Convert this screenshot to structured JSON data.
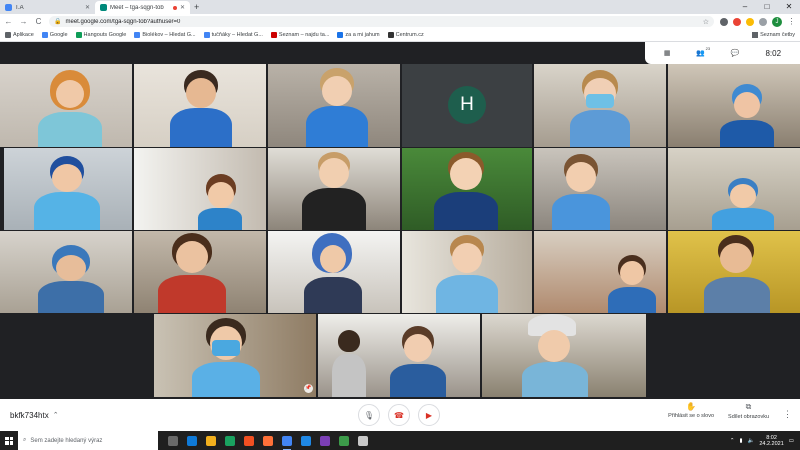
{
  "browser": {
    "tabs": [
      {
        "title": "T.A",
        "active": false,
        "favicon_color": "#4285f4"
      },
      {
        "title": "Meet – tga-sqgn-tob",
        "active": true,
        "favicon_color": "#00897b",
        "recording": true
      }
    ],
    "new_tab": "+",
    "window_controls": {
      "minimize": "–",
      "maximize": "□",
      "close": "✕"
    },
    "nav": {
      "back": "←",
      "forward": "→",
      "reload": "C"
    },
    "url": "meet.google.com/tga-sqgn-tob?authuser=0",
    "profile_initial": "J",
    "bookmarks": [
      {
        "label": "Aplikace",
        "color": "#5f6368"
      },
      {
        "label": "Google",
        "color": "#4285f4"
      },
      {
        "label": "Hangouts Google",
        "color": "#0f9d58"
      },
      {
        "label": "Biolékov – Hledat G...",
        "color": "#4285f4"
      },
      {
        "label": "tučňáky – Hledat G...",
        "color": "#4285f4"
      },
      {
        "label": "Seznam – najdu ta...",
        "color": "#cc0000"
      },
      {
        "label": "za a mi jahum",
        "color": "#1a73e8"
      },
      {
        "label": "Centrum.cz",
        "color": "#333333"
      }
    ],
    "reading_list": "Seznam četby"
  },
  "meet": {
    "participants_count": "23",
    "clock": "8:02",
    "avatar_letter": "H",
    "meeting_code": "bkfk734htx",
    "actions": {
      "raise_hand": "Přihlásit se o slovo",
      "present": "Sdílet obrazovku"
    }
  },
  "taskbar": {
    "search_placeholder": "Sem zadejte hledaný výraz",
    "time": "8:02",
    "date": "24.2.2021"
  }
}
